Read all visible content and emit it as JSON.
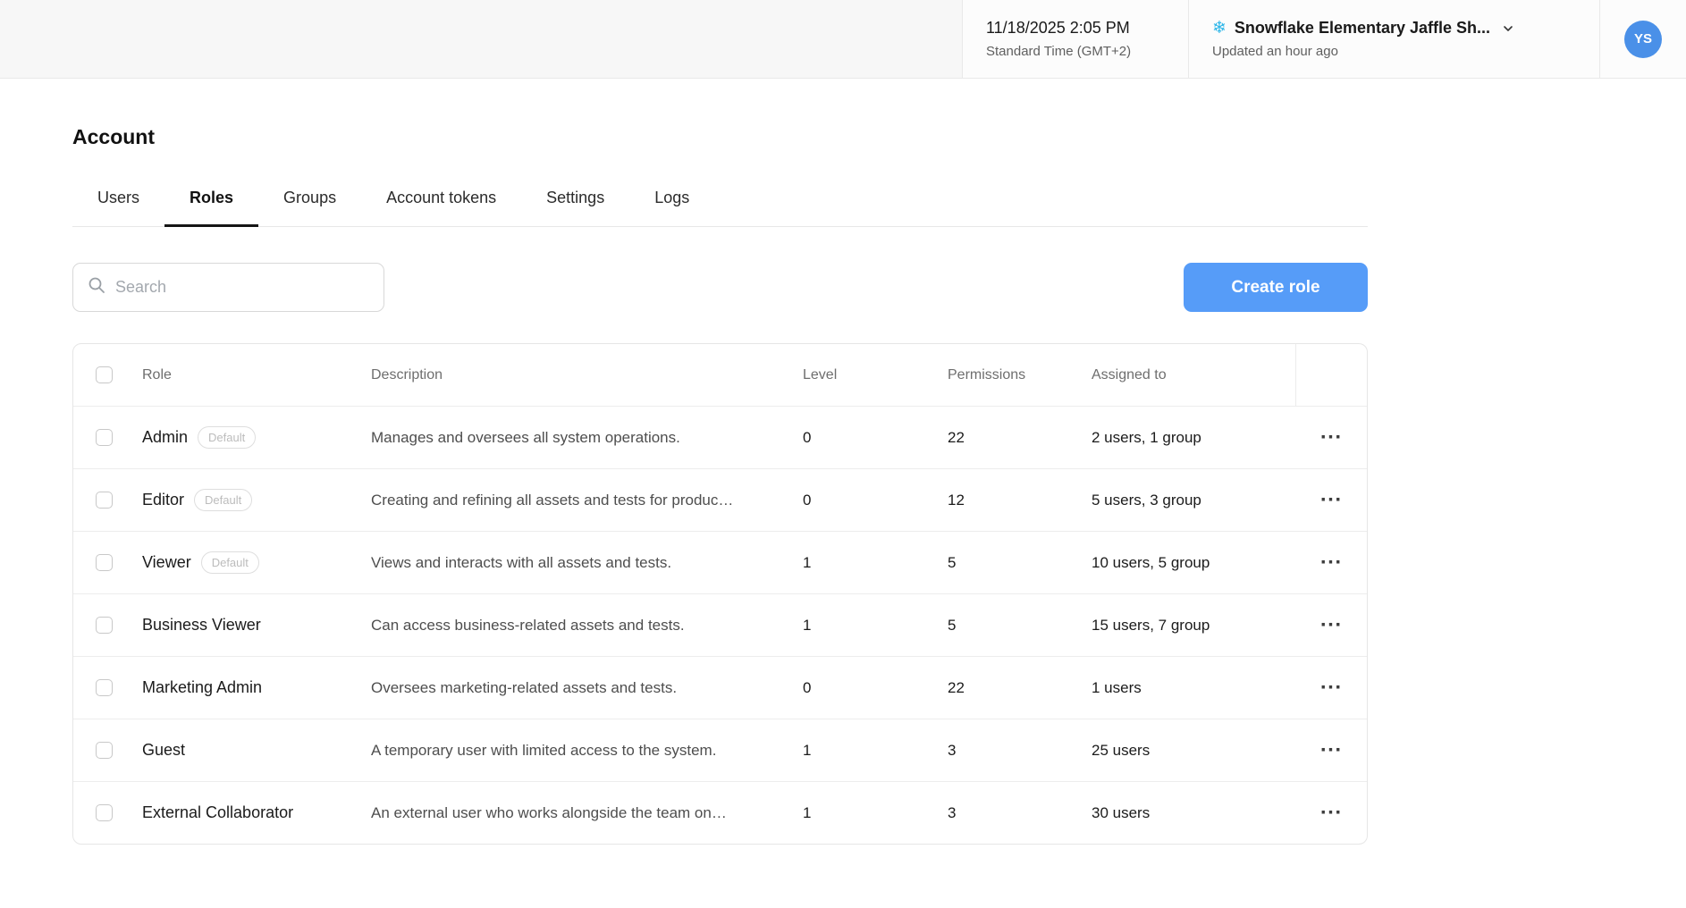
{
  "topbar": {
    "datetime": "11/18/2025 2:05 PM",
    "timezone": "Standard Time (GMT+2)",
    "org_name": "Snowflake Elementary Jaffle Sh...",
    "org_updated": "Updated an hour ago",
    "avatar_initials": "YS"
  },
  "page": {
    "title": "Account",
    "tabs": [
      {
        "label": "Users"
      },
      {
        "label": "Roles"
      },
      {
        "label": "Groups"
      },
      {
        "label": "Account tokens"
      },
      {
        "label": "Settings"
      },
      {
        "label": "Logs"
      }
    ],
    "active_tab": "Roles",
    "search_placeholder": "Search",
    "create_button_label": "Create role"
  },
  "table": {
    "headers": {
      "role": "Role",
      "description": "Description",
      "level": "Level",
      "permissions": "Permissions",
      "assigned": "Assigned to"
    },
    "rows": [
      {
        "role": "Admin",
        "badge": "Default",
        "description": "Manages and oversees all system operations.",
        "level": "0",
        "permissions": "22",
        "assigned": "2 users, 1 group"
      },
      {
        "role": "Editor",
        "badge": "Default",
        "description": "Creating and refining all assets and tests for produc…",
        "level": "0",
        "permissions": "12",
        "assigned": "5 users, 3 group"
      },
      {
        "role": "Viewer",
        "badge": "Default",
        "description": "Views and interacts with all assets and tests.",
        "level": "1",
        "permissions": "5",
        "assigned": "10 users, 5 group"
      },
      {
        "role": "Business Viewer",
        "badge": null,
        "description": "Can access business-related assets and tests.",
        "level": "1",
        "permissions": "5",
        "assigned": "15 users, 7 group"
      },
      {
        "role": "Marketing Admin",
        "badge": null,
        "description": "Oversees marketing-related assets and tests.",
        "level": "0",
        "permissions": "22",
        "assigned": "1 users"
      },
      {
        "role": "Guest",
        "badge": null,
        "description": "A temporary user with limited access to the system.",
        "level": "1",
        "permissions": "3",
        "assigned": "25 users"
      },
      {
        "role": "External Collaborator",
        "badge": null,
        "description": "An external user who works alongside the team on…",
        "level": "1",
        "permissions": "3",
        "assigned": "30 users"
      }
    ]
  },
  "icons": {
    "snowflake": "❄",
    "ellipsis": "···"
  },
  "colors": {
    "accent_blue": "#569CF8",
    "avatar_blue": "#4A90E8",
    "snowflake_blue": "#2BB5E8",
    "topbar_bg": "#F7F7F7",
    "border": "#E9E9E9"
  }
}
